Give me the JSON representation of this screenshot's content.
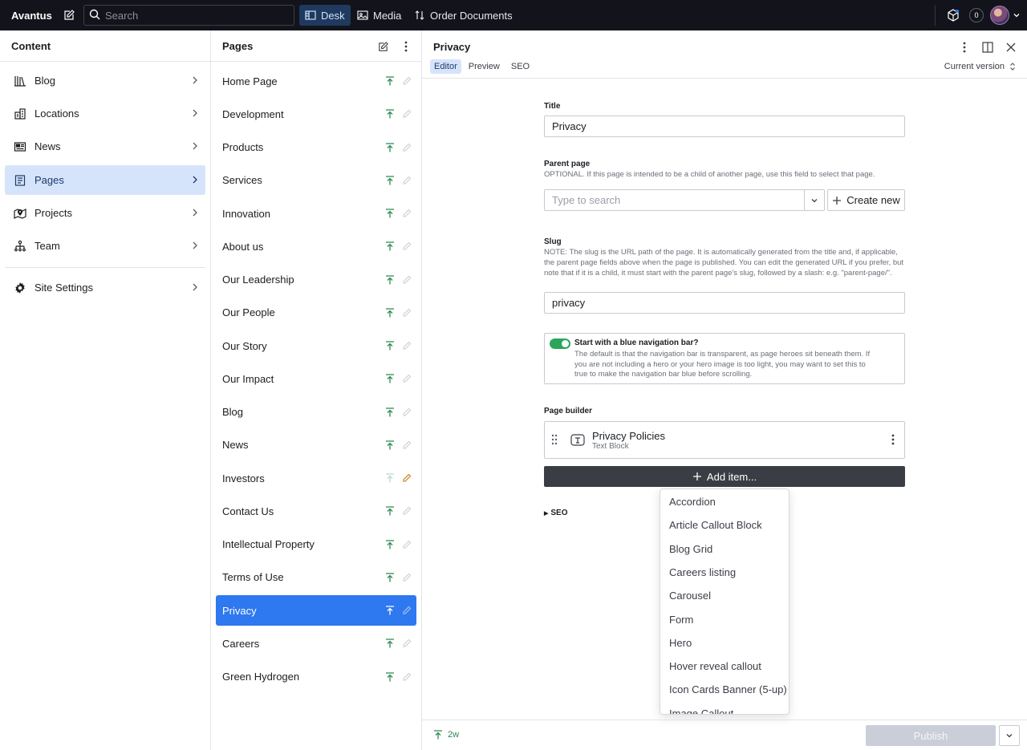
{
  "topbar": {
    "brand": "Avantus",
    "search_placeholder": "Search",
    "tabs": [
      {
        "label": "Desk",
        "icon": "desk-icon"
      },
      {
        "label": "Media",
        "icon": "image-icon"
      },
      {
        "label": "Order Documents",
        "icon": "sort-icon"
      }
    ],
    "notification_count": "0"
  },
  "content": {
    "title": "Content",
    "items": [
      {
        "label": "Blog",
        "icon": "books-icon"
      },
      {
        "label": "Locations",
        "icon": "building-icon"
      },
      {
        "label": "News",
        "icon": "newspaper-icon"
      },
      {
        "label": "Pages",
        "icon": "page-icon"
      },
      {
        "label": "Projects",
        "icon": "map-pin-icon"
      },
      {
        "label": "Team",
        "icon": "org-chart-icon"
      }
    ],
    "settings": {
      "label": "Site Settings",
      "icon": "gear-icon"
    }
  },
  "pages": {
    "title": "Pages",
    "items": [
      {
        "label": "Home Page"
      },
      {
        "label": "Development"
      },
      {
        "label": "Products"
      },
      {
        "label": "Services"
      },
      {
        "label": "Innovation"
      },
      {
        "label": "About us"
      },
      {
        "label": "Our Leadership"
      },
      {
        "label": "Our People"
      },
      {
        "label": "Our Story"
      },
      {
        "label": "Our Impact"
      },
      {
        "label": "Blog"
      },
      {
        "label": "News"
      },
      {
        "label": "Investors"
      },
      {
        "label": "Contact Us"
      },
      {
        "label": "Intellectual Property"
      },
      {
        "label": "Terms of Use"
      },
      {
        "label": "Privacy"
      },
      {
        "label": "Careers"
      },
      {
        "label": "Green Hydrogen"
      }
    ]
  },
  "document": {
    "title": "Privacy",
    "tabs": [
      "Editor",
      "Preview",
      "SEO"
    ],
    "version": "Current version",
    "fields": {
      "title_label": "Title",
      "title_value": "Privacy",
      "parent_label": "Parent page",
      "parent_desc": "OPTIONAL. If this page is intended to be a child of another page, use this field to select that page.",
      "parent_placeholder": "Type to search",
      "create_new": "Create new",
      "slug_label": "Slug",
      "slug_desc": "NOTE: The slug is the URL path of the page. It is automatically generated from the title and, if applicable, the parent page fields above when the page is published. You can edit the generated URL if you prefer, but note that if it is a child, it must start with the parent page's slug, followed by a slash: e.g. \"parent-page/\".",
      "slug_value": "privacy",
      "nav_switch_title": "Start with a blue navigation bar?",
      "nav_switch_desc": "The default is that the navigation bar is transparent, as page heroes sit beneath them. If you are not including a hero or your hero image is too light, you may want to set this to true to make the navigation bar blue before scrolling.",
      "nav_switch_on": true,
      "builder_label": "Page builder",
      "builder_item_name": "Privacy Policies",
      "builder_item_type": "Text Block",
      "add_item": "Add item...",
      "seo_section": "SEO"
    },
    "add_menu": [
      "Accordion",
      "Article Callout Block",
      "Blog Grid",
      "Careers listing",
      "Carousel",
      "Form",
      "Hero",
      "Hover reveal callout",
      "Icon Cards Banner (5-up)",
      "Image Callout"
    ],
    "footer": {
      "status": "2w",
      "publish": "Publish"
    }
  },
  "colors": {
    "topbar": "#13141b",
    "selected_page": "#2e78f0",
    "selected_content": "#d6e4fb",
    "published_green": "#2a8a4e",
    "toggle_on": "#2aa55c"
  }
}
